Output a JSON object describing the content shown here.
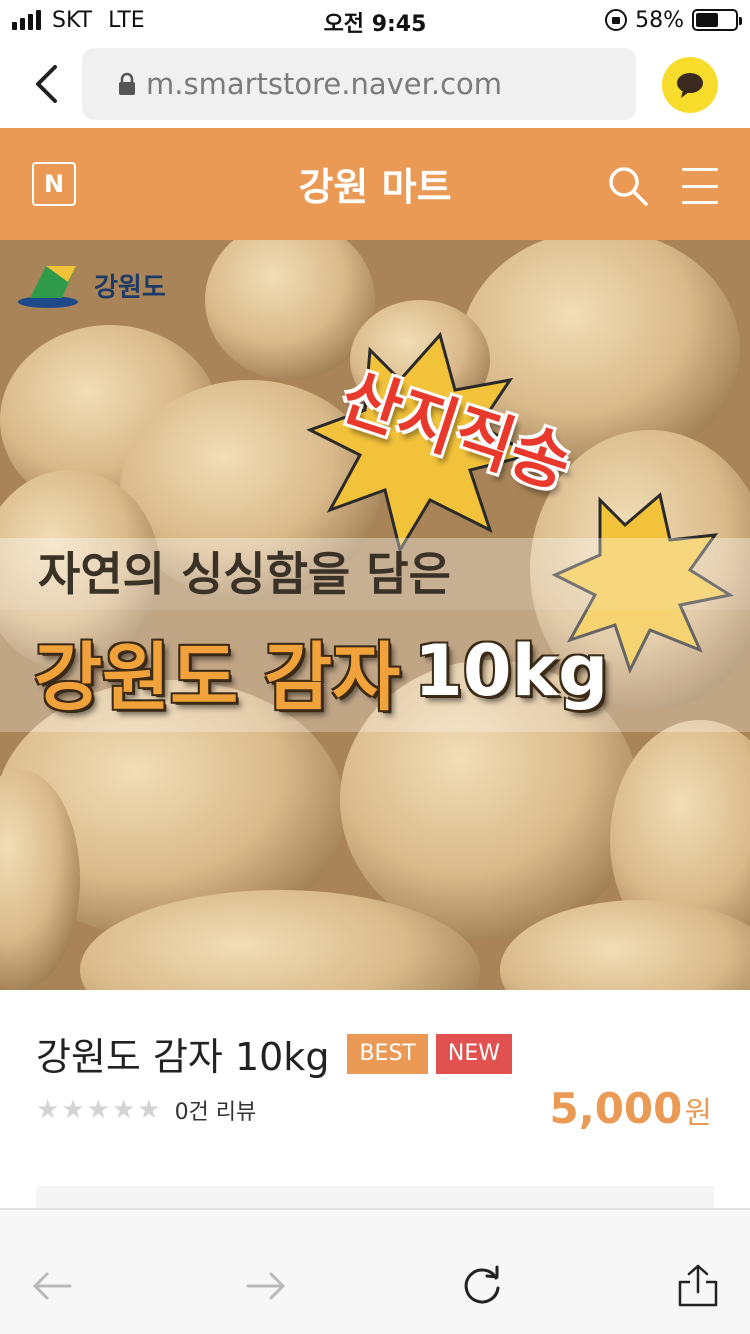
{
  "status_bar": {
    "carrier": "SKT",
    "network": "LTE",
    "time": "오전 9:45",
    "battery_percent": "58%",
    "battery_level": 0.58
  },
  "browser": {
    "url": "m.smartstore.naver.com",
    "back_icon": "chevron-left-icon",
    "talk_icon": "kakaotalk-chat-icon"
  },
  "store": {
    "logo_letter": "N",
    "title": "강원 마트"
  },
  "hero": {
    "region_name": "강원도",
    "stamp_text": "산지직송",
    "subtitle": "자연의 싱싱함을 담은",
    "headline": "강원도 감자",
    "headline_weight": "10kg"
  },
  "product": {
    "title": "강원도 감자 10kg",
    "badges": [
      "BEST",
      "NEW"
    ],
    "rating_stars": 0,
    "review_count": "0건 리뷰",
    "price": "5,000",
    "price_unit": "원"
  },
  "colors": {
    "brand_orange": "#ea9a55",
    "badge_new": "#e0514f",
    "talk_yellow": "#f7dc2c"
  }
}
